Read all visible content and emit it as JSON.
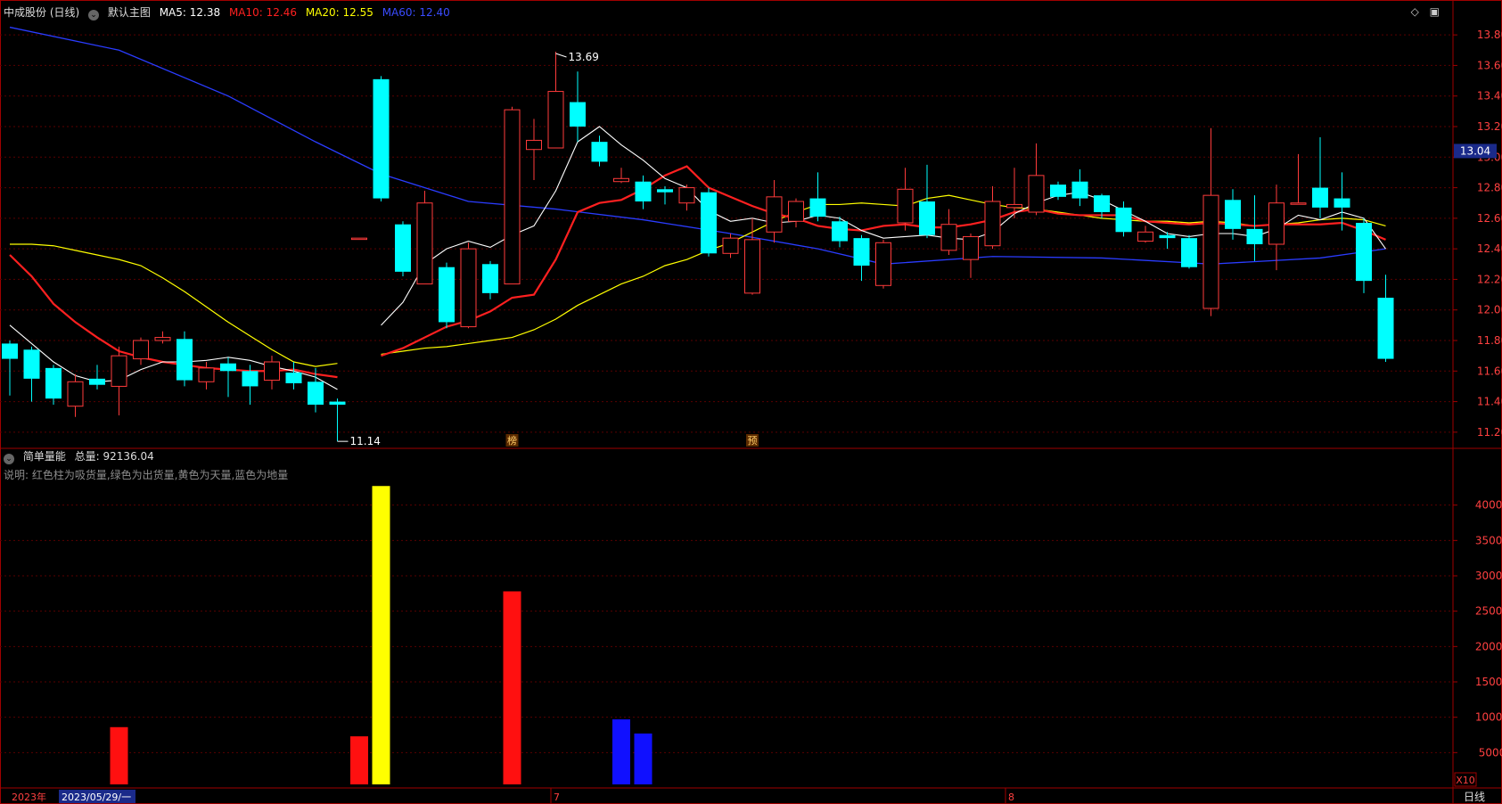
{
  "header": {
    "stock_name": "中成股份 (日线)",
    "template": "默认主图",
    "ma5": {
      "label": "MA5: 12.38",
      "color": "#ffffff"
    },
    "ma10": {
      "label": "MA10: 12.46",
      "color": "#ff2020"
    },
    "ma20": {
      "label": "MA20: 12.55",
      "color": "#ffff00"
    },
    "ma60": {
      "label": "MA60: 12.40",
      "color": "#2a3cff"
    }
  },
  "toolbar_icons": [
    "diamond-icon",
    "window-icon"
  ],
  "price_axis": {
    "ticks": [
      "13.80",
      "13.60",
      "13.40",
      "13.20",
      "13.00",
      "12.80",
      "12.60",
      "12.40",
      "12.20",
      "12.00",
      "11.80",
      "11.60",
      "11.40",
      "11.20"
    ],
    "current_price": "13.04"
  },
  "annotations": {
    "high_label": "13.69",
    "low_label": "11.14",
    "marker_a": "榜",
    "marker_b": "预"
  },
  "volume_panel": {
    "title": "简单量能",
    "total_label": "总量: 92136.04",
    "note": "说明: 红色柱为吸货量,绿色为出货量,黄色为天量,蓝色为地量",
    "axis_ticks": [
      "40000",
      "35000",
      "30000",
      "25000",
      "20000",
      "15000",
      "10000",
      "5000"
    ],
    "multiplier": "X10"
  },
  "time_axis": {
    "year_label": "2023年",
    "cursor_date": "2023/05/29/一",
    "month_7": "7",
    "month_8": "8",
    "period": "日线"
  },
  "colors": {
    "up_candle": "#ff3b3b",
    "down_candle": "#00ffff",
    "grid": "#5a0000",
    "axis_text": "#ff4040",
    "panel_border": "#a00000"
  },
  "chart_data": {
    "type": "candlestick",
    "ylim": [
      11.1,
      13.9
    ],
    "candles": [
      {
        "o": 11.78,
        "c": 11.68,
        "h": 11.8,
        "l": 11.44
      },
      {
        "o": 11.74,
        "c": 11.55,
        "h": 11.76,
        "l": 11.4
      },
      {
        "o": 11.62,
        "c": 11.42,
        "h": 11.64,
        "l": 11.38
      },
      {
        "o": 11.37,
        "c": 11.53,
        "h": 11.58,
        "l": 11.3
      },
      {
        "o": 11.55,
        "c": 11.51,
        "h": 11.64,
        "l": 11.48
      },
      {
        "o": 11.5,
        "c": 11.7,
        "h": 11.76,
        "l": 11.31
      },
      {
        "o": 11.68,
        "c": 11.8,
        "h": 11.82,
        "l": 11.64
      },
      {
        "o": 11.8,
        "c": 11.82,
        "h": 11.86,
        "l": 11.78
      },
      {
        "o": 11.81,
        "c": 11.54,
        "h": 11.86,
        "l": 11.5
      },
      {
        "o": 11.53,
        "c": 11.62,
        "h": 11.66,
        "l": 11.48
      },
      {
        "o": 11.65,
        "c": 11.6,
        "h": 11.69,
        "l": 11.43
      },
      {
        "o": 11.6,
        "c": 11.5,
        "h": 11.64,
        "l": 11.38
      },
      {
        "o": 11.54,
        "c": 11.66,
        "h": 11.7,
        "l": 11.48
      },
      {
        "o": 11.59,
        "c": 11.52,
        "h": 11.66,
        "l": 11.48
      },
      {
        "o": 11.53,
        "c": 11.38,
        "h": 11.62,
        "l": 11.33
      },
      {
        "o": 11.4,
        "c": 11.38,
        "h": 11.42,
        "l": 11.14
      },
      {
        "o": 12.47,
        "c": 12.47,
        "h": 12.47,
        "l": 12.47
      },
      {
        "o": 13.51,
        "c": 12.73,
        "h": 13.53,
        "l": 12.71
      },
      {
        "o": 12.56,
        "c": 12.25,
        "h": 12.58,
        "l": 12.22
      },
      {
        "o": 12.17,
        "c": 12.7,
        "h": 12.78,
        "l": 12.17
      },
      {
        "o": 12.28,
        "c": 11.92,
        "h": 12.31,
        "l": 11.88
      },
      {
        "o": 11.89,
        "c": 12.4,
        "h": 12.44,
        "l": 11.88
      },
      {
        "o": 12.3,
        "c": 12.11,
        "h": 12.32,
        "l": 12.07
      },
      {
        "o": 12.17,
        "c": 13.31,
        "h": 13.33,
        "l": 12.17
      },
      {
        "o": 13.05,
        "c": 13.11,
        "h": 13.25,
        "l": 12.85
      },
      {
        "o": 13.06,
        "c": 13.43,
        "h": 13.69,
        "l": 13.06
      },
      {
        "o": 13.36,
        "c": 13.2,
        "h": 13.56,
        "l": 13.1
      },
      {
        "o": 13.1,
        "c": 12.97,
        "h": 13.14,
        "l": 12.94
      },
      {
        "o": 12.84,
        "c": 12.86,
        "h": 12.93,
        "l": 12.83
      },
      {
        "o": 12.84,
        "c": 12.71,
        "h": 12.88,
        "l": 12.66
      },
      {
        "o": 12.79,
        "c": 12.77,
        "h": 12.81,
        "l": 12.69
      },
      {
        "o": 12.7,
        "c": 12.8,
        "h": 12.82,
        "l": 12.65
      },
      {
        "o": 12.77,
        "c": 12.37,
        "h": 12.8,
        "l": 12.35
      },
      {
        "o": 12.37,
        "c": 12.47,
        "h": 12.5,
        "l": 12.34
      },
      {
        "o": 12.11,
        "c": 12.46,
        "h": 12.6,
        "l": 12.1
      },
      {
        "o": 12.51,
        "c": 12.74,
        "h": 12.85,
        "l": 12.44
      },
      {
        "o": 12.58,
        "c": 12.71,
        "h": 12.73,
        "l": 12.54
      },
      {
        "o": 12.73,
        "c": 12.61,
        "h": 12.9,
        "l": 12.58
      },
      {
        "o": 12.58,
        "c": 12.45,
        "h": 12.61,
        "l": 12.41
      },
      {
        "o": 12.47,
        "c": 12.29,
        "h": 12.49,
        "l": 12.19
      },
      {
        "o": 12.16,
        "c": 12.44,
        "h": 12.46,
        "l": 12.14
      },
      {
        "o": 12.57,
        "c": 12.79,
        "h": 12.93,
        "l": 12.52
      },
      {
        "o": 12.71,
        "c": 12.49,
        "h": 12.95,
        "l": 12.47
      },
      {
        "o": 12.39,
        "c": 12.56,
        "h": 12.66,
        "l": 12.36
      },
      {
        "o": 12.33,
        "c": 12.48,
        "h": 12.5,
        "l": 12.21
      },
      {
        "o": 12.42,
        "c": 12.71,
        "h": 12.81,
        "l": 12.4
      },
      {
        "o": 12.67,
        "c": 12.69,
        "h": 12.93,
        "l": 12.6
      },
      {
        "o": 12.64,
        "c": 12.88,
        "h": 13.09,
        "l": 12.62
      },
      {
        "o": 12.82,
        "c": 12.74,
        "h": 12.84,
        "l": 12.72
      },
      {
        "o": 12.84,
        "c": 12.73,
        "h": 12.92,
        "l": 12.68
      },
      {
        "o": 12.75,
        "c": 12.64,
        "h": 12.76,
        "l": 12.6
      },
      {
        "o": 12.67,
        "c": 12.51,
        "h": 12.71,
        "l": 12.48
      },
      {
        "o": 12.45,
        "c": 12.51,
        "h": 12.55,
        "l": 12.44
      },
      {
        "o": 12.49,
        "c": 12.47,
        "h": 12.51,
        "l": 12.4
      },
      {
        "o": 12.47,
        "c": 12.28,
        "h": 12.49,
        "l": 12.27
      },
      {
        "o": 12.01,
        "c": 12.75,
        "h": 13.19,
        "l": 11.96
      },
      {
        "o": 12.72,
        "c": 12.53,
        "h": 12.79,
        "l": 12.46
      },
      {
        "o": 12.53,
        "c": 12.43,
        "h": 12.75,
        "l": 12.32
      },
      {
        "o": 12.43,
        "c": 12.7,
        "h": 12.82,
        "l": 12.26
      },
      {
        "o": 12.7,
        "c": 12.7,
        "h": 13.02,
        "l": 12.7
      },
      {
        "o": 12.8,
        "c": 12.67,
        "h": 13.13,
        "l": 12.6
      },
      {
        "o": 12.73,
        "c": 12.67,
        "h": 12.9,
        "l": 12.52
      },
      {
        "o": 12.57,
        "c": 12.19,
        "h": 12.6,
        "l": 12.11
      },
      {
        "o": 12.08,
        "c": 11.68,
        "h": 12.23,
        "l": 11.66
      }
    ],
    "ma5": [
      11.9,
      11.78,
      11.66,
      11.57,
      11.53,
      11.54,
      11.61,
      11.66,
      11.66,
      11.67,
      11.69,
      11.67,
      11.63,
      11.6,
      11.56,
      11.48,
      null,
      11.9,
      12.05,
      12.3,
      12.4,
      12.45,
      12.41,
      12.49,
      12.55,
      12.78,
      13.1,
      13.2,
      13.08,
      12.98,
      12.86,
      12.8,
      12.65,
      12.58,
      12.6,
      12.57,
      12.58,
      12.62,
      12.6,
      12.52,
      12.47,
      12.48,
      12.49,
      12.47,
      12.46,
      12.51,
      12.63,
      12.7,
      12.75,
      12.77,
      12.72,
      12.65,
      12.58,
      12.5,
      12.48,
      12.5,
      12.5,
      12.48,
      12.53,
      12.62,
      12.59,
      12.64,
      12.6,
      12.4
    ],
    "ma10": [
      12.36,
      12.22,
      12.04,
      11.92,
      11.82,
      11.73,
      11.69,
      11.66,
      11.64,
      11.62,
      11.61,
      11.6,
      11.6,
      11.61,
      11.58,
      11.56,
      null,
      11.7,
      11.75,
      11.82,
      11.89,
      11.93,
      11.99,
      12.08,
      12.1,
      12.33,
      12.64,
      12.7,
      12.72,
      12.79,
      12.88,
      12.94,
      12.8,
      12.74,
      12.68,
      12.63,
      12.6,
      12.55,
      12.53,
      12.52,
      12.55,
      12.56,
      12.54,
      12.54,
      12.56,
      12.59,
      12.64,
      12.66,
      12.63,
      12.62,
      12.62,
      12.62,
      12.58,
      12.57,
      12.56,
      12.57,
      12.56,
      12.55,
      12.56,
      12.56,
      12.56,
      12.57,
      12.52,
      12.46
    ],
    "ma20": [
      12.43,
      12.43,
      12.42,
      12.39,
      12.36,
      12.33,
      12.29,
      12.21,
      12.12,
      12.02,
      11.92,
      11.83,
      11.74,
      11.66,
      11.63,
      11.65,
      null,
      11.71,
      11.73,
      11.75,
      11.76,
      11.78,
      11.8,
      11.82,
      11.87,
      11.94,
      12.03,
      12.1,
      12.17,
      12.22,
      12.29,
      12.33,
      12.39,
      12.44,
      12.51,
      12.58,
      12.64,
      12.69,
      12.69,
      12.7,
      12.69,
      12.68,
      12.73,
      12.75,
      12.72,
      12.69,
      12.67,
      12.66,
      12.64,
      12.62,
      12.6,
      12.59,
      12.58,
      12.58,
      12.57,
      12.58,
      12.57,
      12.55,
      12.56,
      12.57,
      12.59,
      12.6,
      12.59,
      12.55
    ],
    "ma60_points": [
      [
        0,
        13.85
      ],
      [
        5,
        13.7
      ],
      [
        10,
        13.4
      ],
      [
        14,
        13.1
      ],
      [
        17,
        12.89
      ],
      [
        21,
        12.71
      ],
      [
        25,
        12.66
      ],
      [
        29,
        12.59
      ],
      [
        33,
        12.5
      ],
      [
        37,
        12.4
      ],
      [
        40,
        12.3
      ],
      [
        45,
        12.35
      ],
      [
        50,
        12.34
      ],
      [
        55,
        12.3
      ],
      [
        60,
        12.34
      ],
      [
        63,
        12.4
      ]
    ],
    "volume_bars": [
      {
        "i": 5,
        "v": 8600,
        "color": "#ff1010"
      },
      {
        "i": 16,
        "v": 7300,
        "color": "#ff1010"
      },
      {
        "i": 17,
        "v": 42700,
        "color": "#ffff00"
      },
      {
        "i": 23,
        "v": 27800,
        "color": "#ff1010"
      },
      {
        "i": 28,
        "v": 9700,
        "color": "#1010ff"
      },
      {
        "i": 29,
        "v": 7700,
        "color": "#1010ff"
      }
    ],
    "volume_ylim": [
      0,
      45000
    ]
  }
}
